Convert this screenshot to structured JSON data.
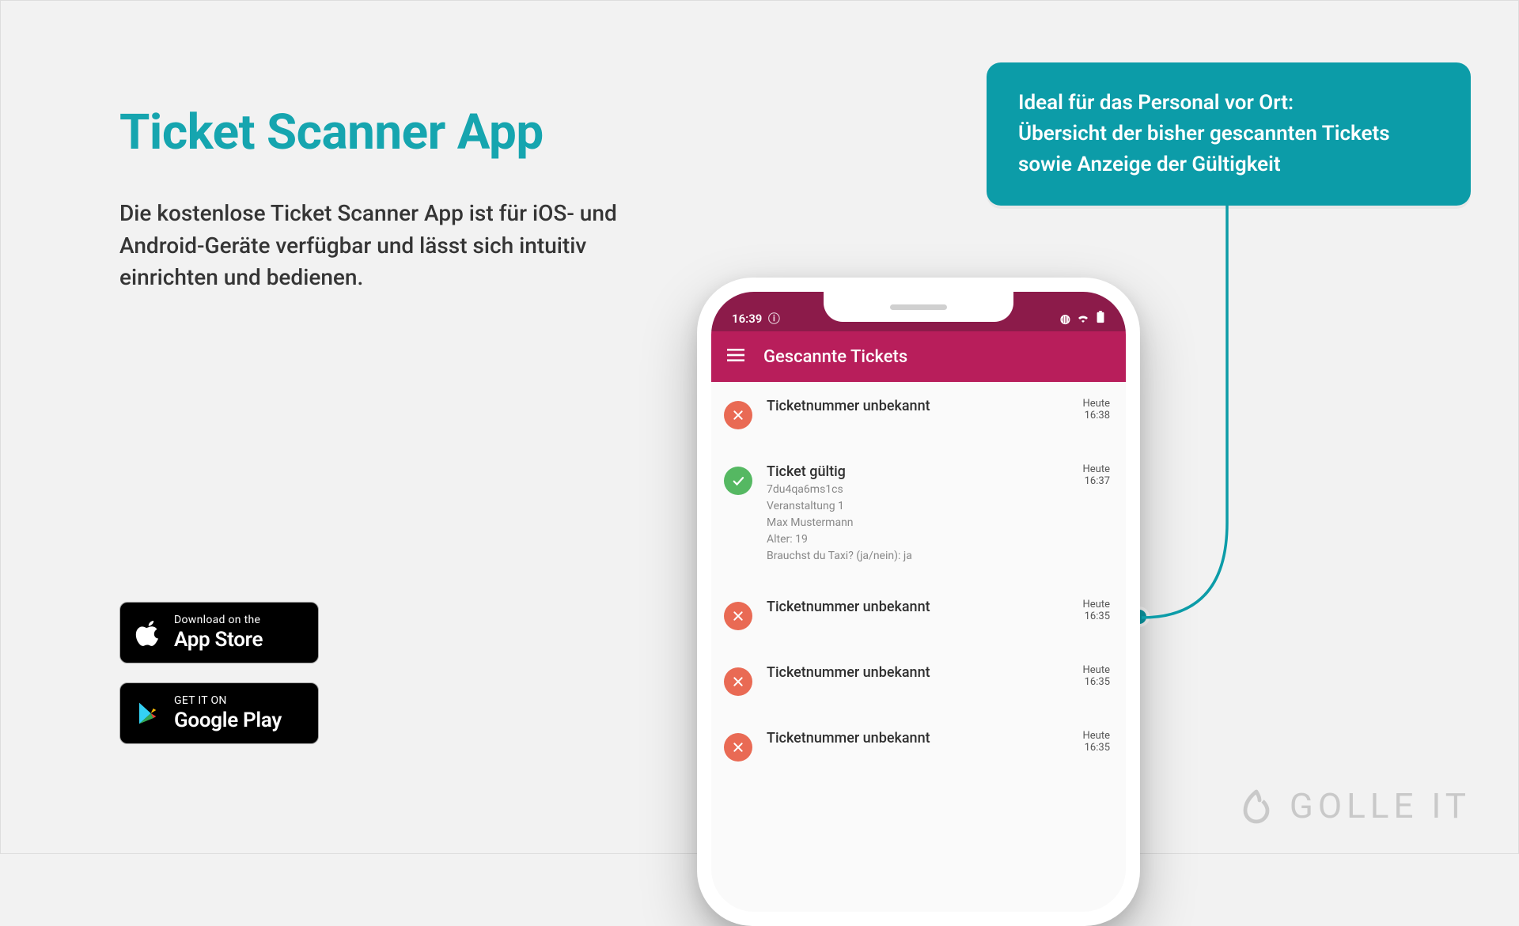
{
  "colors": {
    "accent": "#16a5af",
    "callout": "#0c9ca8",
    "phoneHeader": "#b81e5b",
    "phoneStatus": "#8c1b4a"
  },
  "hero": {
    "title": "Ticket Scanner App",
    "description": "Die kostenlose Ticket Scanner App ist für iOS- und Android-Geräte verfügbar und lässt sich intuitiv einrichten und bedienen."
  },
  "callout": {
    "line1": "Ideal für das Personal vor Ort:",
    "line2": "Übersicht der bisher gescannten Tickets sowie Anzeige der Gültigkeit"
  },
  "store": {
    "apple_small": "Download on the",
    "apple_big": "App Store",
    "google_small": "GET IT ON",
    "google_big": "Google Play"
  },
  "brand": {
    "name": "GOLLE IT"
  },
  "phone": {
    "time": "16:39",
    "appbar_title": "Gescannte Tickets",
    "rows": [
      {
        "status": "bad",
        "title": "Ticketnummer unbekannt",
        "details": [],
        "day": "Heute",
        "time": "16:38"
      },
      {
        "status": "ok",
        "title": "Ticket gültig",
        "details": [
          "7du4qa6ms1cs",
          "Veranstaltung 1",
          "Max Mustermann",
          "Alter: 19",
          "Brauchst du Taxi? (ja/nein): ja"
        ],
        "day": "Heute",
        "time": "16:37"
      },
      {
        "status": "bad",
        "title": "Ticketnummer unbekannt",
        "details": [],
        "day": "Heute",
        "time": "16:35"
      },
      {
        "status": "bad",
        "title": "Ticketnummer unbekannt",
        "details": [],
        "day": "Heute",
        "time": "16:35"
      },
      {
        "status": "bad",
        "title": "Ticketnummer unbekannt",
        "details": [],
        "day": "Heute",
        "time": "16:35"
      }
    ]
  }
}
